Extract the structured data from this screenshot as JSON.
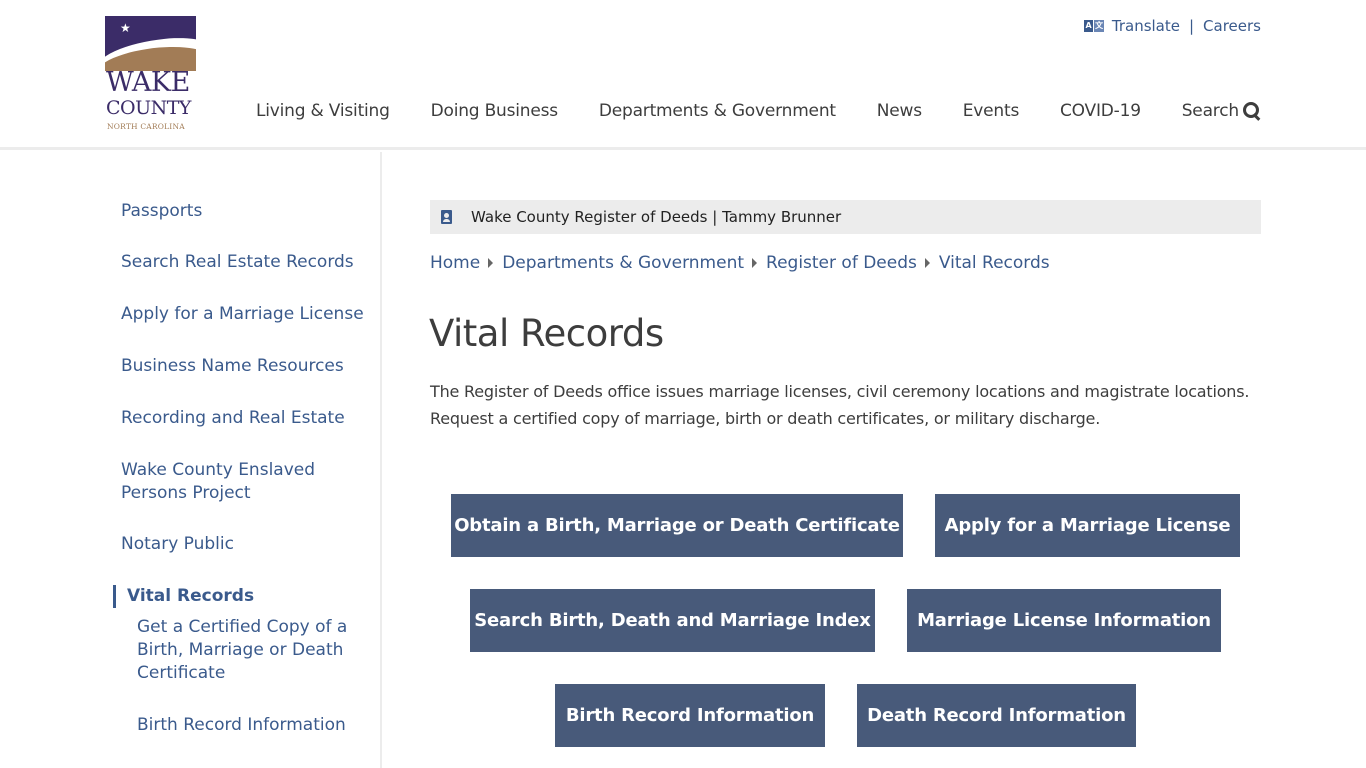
{
  "logo": {
    "line1": "WAKE",
    "line2": "COUNTY",
    "line3": "NORTH CAROLINA",
    "colors": {
      "purple": "#3b2c68",
      "tan": "#a27c56"
    }
  },
  "utility": {
    "translate_icon": "translate-icon",
    "translate": "Translate",
    "separator": "|",
    "careers": "Careers"
  },
  "nav": {
    "items": [
      "Living & Visiting",
      "Doing Business",
      "Departments & Government",
      "News",
      "Events",
      "COVID-19"
    ],
    "search_label": "Search",
    "search_icon": "search-icon"
  },
  "sidebar": {
    "items": [
      "Passports",
      "Search Real Estate Records",
      "Apply for a Marriage License",
      "Business Name Resources",
      "Recording and Real Estate",
      "Wake County Enslaved Persons Project",
      "Notary Public"
    ],
    "active": "Vital Records",
    "subitems": [
      "Get a Certified Copy of a Birth, Marriage or Death Certificate",
      "Birth Record Information"
    ]
  },
  "notice": {
    "icon": "document-user-icon",
    "text": "Wake County Register of Deeds | Tammy Brunner"
  },
  "breadcrumb": {
    "items": [
      "Home",
      "Departments & Government",
      "Register of Deeds"
    ],
    "current": "Vital Records"
  },
  "page": {
    "title": "Vital Records",
    "intro": "The Register of Deeds office issues marriage licenses, civil ceremony locations and magistrate locations. Request a certified copy of marriage, birth or death certificates, or military discharge."
  },
  "buttons": [
    "Obtain a Birth, Marriage or Death Certificate",
    "Apply for a Marriage License",
    "Search Birth, Death and Marriage Index",
    "Marriage License Information",
    "Birth Record Information",
    "Death Record Information"
  ],
  "colors": {
    "link": "#3a5a8c",
    "button_bg": "#485a7a",
    "notice_bg": "#ececec",
    "text": "#3d3d3d"
  }
}
